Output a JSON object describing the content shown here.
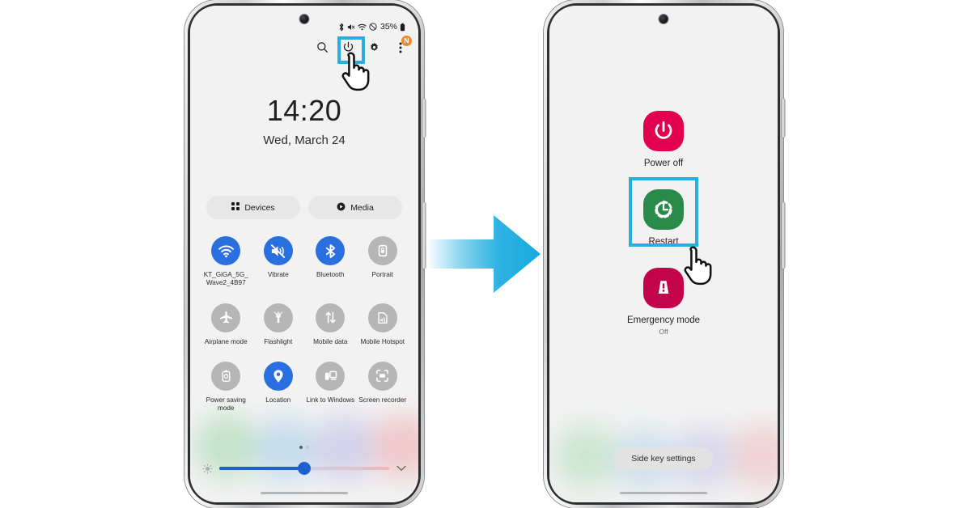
{
  "colors": {
    "highlight": "#2aaede",
    "arrow": "#21aee0",
    "accent_blue": "#2a6fe0",
    "power_off_red": "#e3004f",
    "restart_green": "#2a8a4a",
    "emergency_red": "#c3044b",
    "badge_orange": "#f08a28"
  },
  "left_phone": {
    "status_bar": {
      "icons": [
        "bluetooth-icon",
        "mute-icon",
        "wifi-icon",
        "do-not-disturb-icon"
      ],
      "battery_percent": "35%",
      "battery_icon": "battery-icon"
    },
    "top_icons": [
      {
        "name": "search-icon",
        "label": "Search"
      },
      {
        "name": "power-icon",
        "label": "Power",
        "highlighted": true
      },
      {
        "name": "gear-icon",
        "label": "Settings"
      },
      {
        "name": "more-options-icon",
        "label": "More options",
        "badge": "N"
      }
    ],
    "clock": {
      "time": "14:20",
      "date": "Wed, March 24"
    },
    "pills": [
      {
        "icon": "devices-grid-icon",
        "label": "Devices"
      },
      {
        "icon": "media-play-icon",
        "label": "Media"
      }
    ],
    "toggles": [
      [
        {
          "icon": "wifi-icon",
          "label": "KT_GiGA_5G_Wave2_4B97",
          "state": "on"
        },
        {
          "icon": "vibrate-icon",
          "label": "Vibrate",
          "state": "on"
        },
        {
          "icon": "bluetooth-icon",
          "label": "Bluetooth",
          "state": "on"
        },
        {
          "icon": "rotation-lock-icon",
          "label": "Portrait",
          "state": "off"
        }
      ],
      [
        {
          "icon": "airplane-icon",
          "label": "Airplane mode",
          "state": "off"
        },
        {
          "icon": "flashlight-icon",
          "label": "Flashlight",
          "state": "off"
        },
        {
          "icon": "mobile-data-icon",
          "label": "Mobile data",
          "state": "off"
        },
        {
          "icon": "hotspot-icon",
          "label": "Mobile Hotspot",
          "state": "off"
        }
      ],
      [
        {
          "icon": "battery-saver-icon",
          "label": "Power saving mode",
          "state": "off"
        },
        {
          "icon": "location-pin-icon",
          "label": "Location",
          "state": "on"
        },
        {
          "icon": "link-to-windows-icon",
          "label": "Link to Windows",
          "state": "off"
        },
        {
          "icon": "screen-recorder-icon",
          "label": "Screen recorder",
          "state": "off"
        }
      ]
    ],
    "page_dots": {
      "count": 2,
      "active_index": 0
    },
    "brightness": {
      "left_icon": "brightness-low-icon",
      "value_percent": 50,
      "expand_icon": "chevron-down-icon"
    }
  },
  "right_phone": {
    "menu_items": [
      {
        "icon": "power-off-icon",
        "label": "Power off",
        "sub": ""
      },
      {
        "icon": "restart-icon",
        "label": "Restart",
        "sub": "",
        "highlighted": true
      },
      {
        "icon": "emergency-icon",
        "label": "Emergency mode",
        "sub": "Off"
      }
    ],
    "side_key_button": "Side key settings"
  },
  "flow": {
    "arrow": "right-arrow",
    "cursor": "pointing-hand-cursor"
  }
}
